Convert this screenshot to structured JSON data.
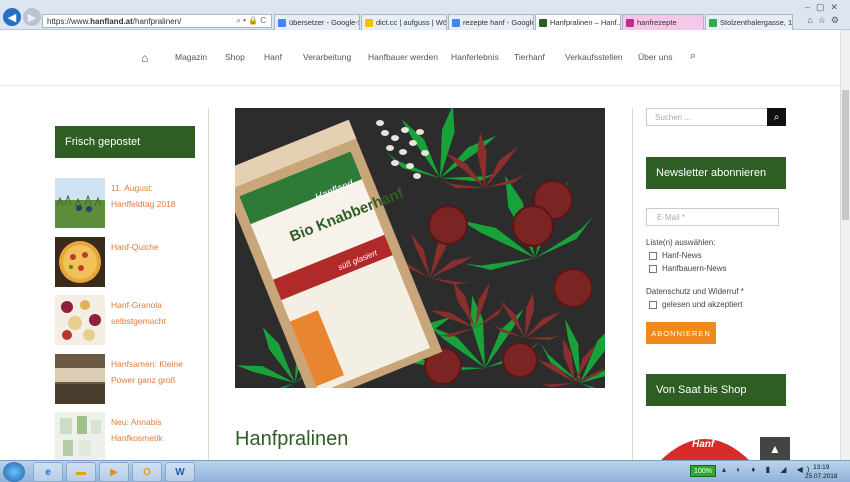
{
  "browser": {
    "url_prefix": "https://www.",
    "url_host": "hanfland.at",
    "url_path": "/hanfpralinen/",
    "tabs": [
      {
        "label": "übersetzer - Google-Su...",
        "color": "#ffffff"
      },
      {
        "label": "dict.cc | aufguss | Wört...",
        "color": "#f2c200"
      },
      {
        "label": "rezepte hanf - Google-...",
        "color": "#ffffff"
      },
      {
        "label": "Hanfpralinen – Hanf... ×",
        "color": "#ffffff"
      },
      {
        "label": "hanfrezepte",
        "color": "#f5c7e9"
      },
      {
        "label": "Stolzenthalergasse, 108...",
        "color": "#ffffff"
      }
    ]
  },
  "nav": {
    "items": [
      "Magazin",
      "Shop",
      "Hanf",
      "Verarbeitung",
      "Hanfbauer werden",
      "Hanferlebnis",
      "Tierhanf",
      "Verkaufsstellen",
      "Über uns"
    ]
  },
  "left_sidebar": {
    "title": "Frisch gepostet",
    "posts": [
      {
        "title_line1": "11. August:",
        "title_line2": "Hanffeldtag 2018"
      },
      {
        "title_line1": "Hanf-Quiche",
        "title_line2": ""
      },
      {
        "title_line1": "Hanf-Granola",
        "title_line2": "selbstgemacht"
      },
      {
        "title_line1": "Hanfsamen: Kleine",
        "title_line2": "Power ganz groß"
      },
      {
        "title_line1": "Neu: Annabis",
        "title_line2": "Hanfkosmetik"
      }
    ]
  },
  "main": {
    "page_title": "Hanfpralinen",
    "package_text": "Bio Knabberhanf",
    "brand": "Hanfland",
    "package_band": "süß glasiert"
  },
  "right_sidebar": {
    "search_placeholder": "Suchen ...",
    "newsletter_title": "Newsletter abonnieren",
    "email_placeholder": "E-Mail *",
    "lists_label": "Liste(n) auswählen:",
    "list_options": [
      "Hanf-News",
      "Hanfbauern-News"
    ],
    "privacy_label": "Datenschutz und Widerruf *",
    "privacy_option": "gelesen und akzeptiert",
    "subscribe_label": "ABONNIEREN",
    "shop_title": "Von Saat bis Shop",
    "shop_logo_text": "Hanf"
  },
  "taskbar": {
    "battery": "100%",
    "time": "13:19",
    "date": "25.07.2018"
  },
  "colors": {
    "green": "#2e5e24",
    "orange_link": "#e07b3a",
    "button_orange": "#f08a1c"
  }
}
